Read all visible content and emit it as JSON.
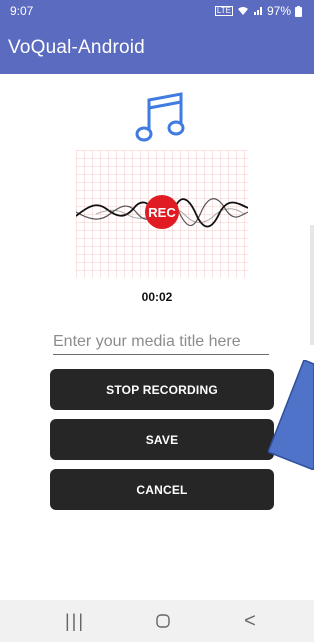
{
  "status_bar": {
    "time": "9:07",
    "battery": "97%",
    "network_icon": "volte-icon",
    "wifi_icon": "wifi-icon",
    "signal_icon": "signal-icon",
    "battery_icon": "battery-icon"
  },
  "app_bar": {
    "title": "VoQual-Android"
  },
  "recording": {
    "music_icon": "music-note-icon",
    "rec_label": "REC",
    "timer": "00:02"
  },
  "form": {
    "title_placeholder": "Enter your media title here"
  },
  "buttons": {
    "stop": "STOP RECORDING",
    "save": "SAVE",
    "cancel": "CANCEL"
  },
  "nav_bar": {
    "recents": "|||",
    "home": "home-icon",
    "back": "<"
  },
  "colors": {
    "app_bar": "#5b6bbf",
    "button": "#262626",
    "rec": "#e01b24",
    "music_icon": "#3f7be0",
    "arrow_fill": "#4f73c9"
  }
}
